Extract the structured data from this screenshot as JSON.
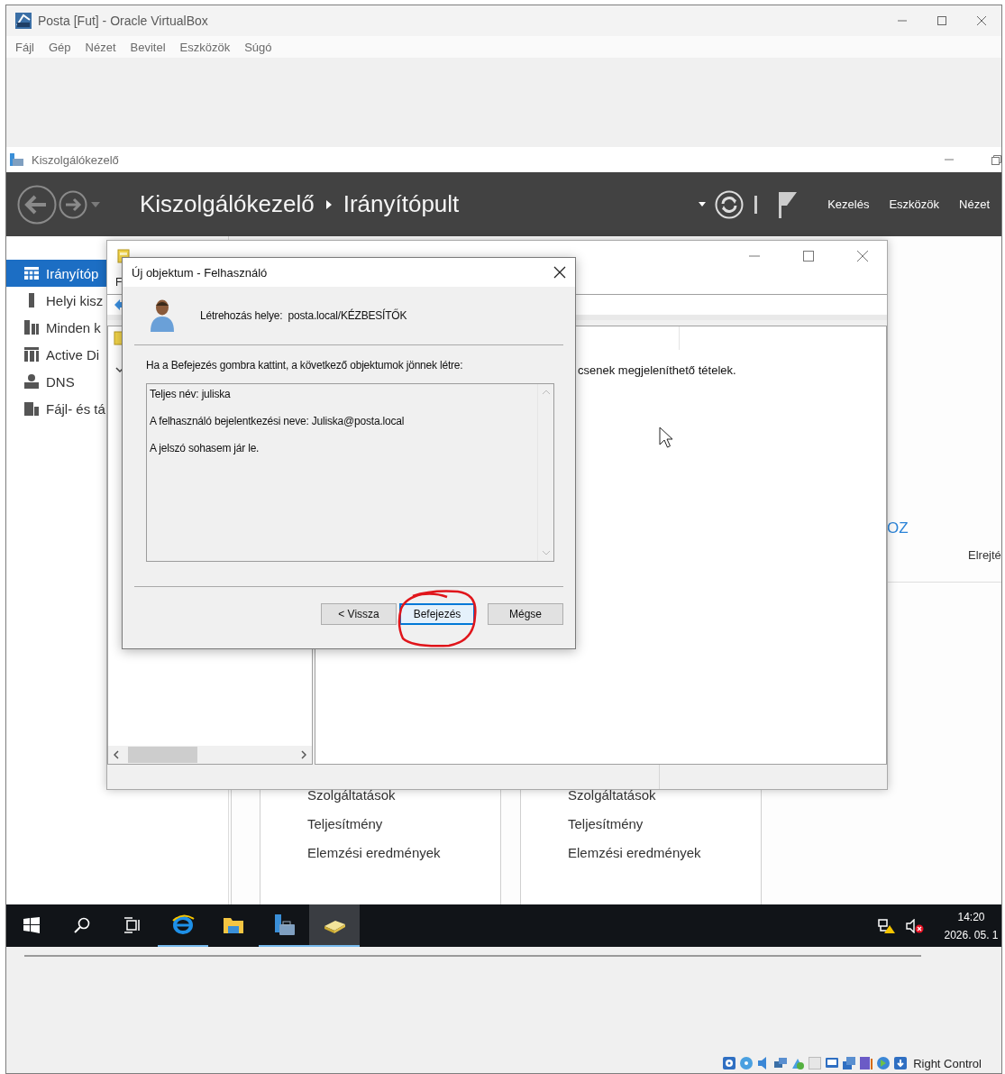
{
  "vbox_window": {
    "title": "Posta [Fut] - Oracle VirtualBox",
    "menu": [
      "Fájl",
      "Gép",
      "Nézet",
      "Bevitel",
      "Eszközök",
      "Súgó"
    ],
    "status_text": "Right Control"
  },
  "server_manager": {
    "title": "Kiszolgálókezelő",
    "breadcrumb": [
      "Kiszolgálókezelő",
      "Irányítópult"
    ],
    "header_menu": [
      "Kezelés",
      "Eszközök",
      "Nézet"
    ],
    "sidebar": [
      {
        "kind": "dashboard",
        "label": "Irányítóp",
        "selected": true
      },
      {
        "kind": "server",
        "label": "Helyi kisz",
        "selected": false
      },
      {
        "kind": "servers",
        "label": "Minden k",
        "selected": false
      },
      {
        "kind": "directory",
        "label": "Active Di",
        "selected": false
      },
      {
        "kind": "dns",
        "label": "DNS",
        "selected": false
      },
      {
        "kind": "files",
        "label": "Fájl- és tá",
        "selected": false
      }
    ],
    "link_fragment": "OZ",
    "hide_fragment": "Elrejté",
    "tiles": [
      {
        "items": [
          "Szolgáltatások",
          "Teljesítmény",
          "Elemzési eredmények"
        ]
      },
      {
        "items": [
          "Szolgáltatások",
          "Teljesítmény",
          "Elemzési eredmények"
        ]
      }
    ]
  },
  "ad_window": {
    "menu_fragment": "F",
    "message_fragment": "csenek megjeleníthető tételek."
  },
  "dialog": {
    "title": "Új objektum - Felhasználó",
    "location_label": "Létrehozás helye:",
    "location_value": "posta.local/KÉZBESÍTŐK",
    "intro": "Ha a Befejezés gombra kattint, a következő objektumok jönnek létre:",
    "summary": [
      "Teljes név: juliska",
      "A felhasználó bejelentkezési neve: Juliska@posta.local",
      "A jelszó sohasem jár le."
    ],
    "buttons": [
      {
        "label": "< Vissza",
        "default": false
      },
      {
        "label": "Befejezés",
        "default": true
      },
      {
        "label": "Mégse",
        "default": false
      }
    ]
  },
  "taskbar": {
    "apps": [
      {
        "kind": "browser",
        "running": true,
        "selected": false
      },
      {
        "kind": "folder",
        "running": false,
        "selected": false
      },
      {
        "kind": "server-manager",
        "running": true,
        "selected": false
      },
      {
        "kind": "directory",
        "running": true,
        "selected": true
      }
    ],
    "time": "14:20",
    "date": "2026. 05. 1"
  }
}
